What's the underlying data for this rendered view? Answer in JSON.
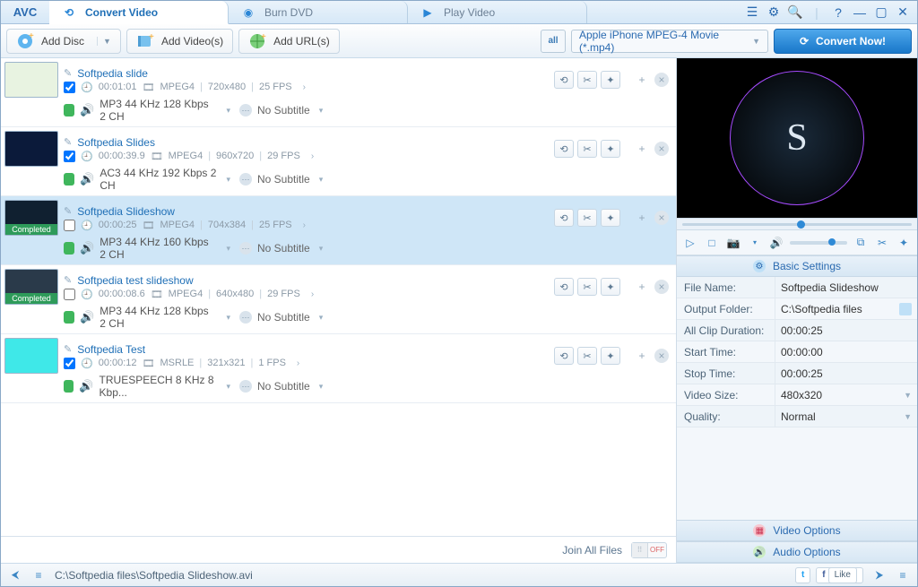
{
  "app": {
    "logo": "AVC"
  },
  "tabs": [
    {
      "label": "Convert Video",
      "active": true
    },
    {
      "label": "Burn DVD",
      "active": false
    },
    {
      "label": "Play Video",
      "active": false
    }
  ],
  "toolbar": {
    "add_disc": "Add Disc",
    "add_videos": "Add Video(s)",
    "add_urls": "Add URL(s)",
    "profile_tag": "all",
    "profile_label": "Apple iPhone MPEG-4 Movie (*.mp4)",
    "convert": "Convert Now!"
  },
  "items": [
    {
      "title": "Softpedia slide",
      "checked": true,
      "completed": false,
      "selected": false,
      "duration": "00:01:01",
      "codec": "MPEG4",
      "res": "720x480",
      "fps": "25 FPS",
      "audio": "MP3 44 KHz 128 Kbps 2 CH",
      "subtitle": "No Subtitle",
      "thumb_bg": "#e8f3e1"
    },
    {
      "title": "Softpedia Slides",
      "checked": true,
      "completed": false,
      "selected": false,
      "duration": "00:00:39.9",
      "codec": "MPEG4",
      "res": "960x720",
      "fps": "29 FPS",
      "audio": "AC3 44 KHz 192 Kbps 2 CH",
      "subtitle": "No Subtitle",
      "thumb_bg": "#0b1a3a"
    },
    {
      "title": "Softpedia Slideshow",
      "checked": false,
      "completed": true,
      "selected": true,
      "duration": "00:00:25",
      "codec": "MPEG4",
      "res": "704x384",
      "fps": "25 FPS",
      "audio": "MP3 44 KHz 160 Kbps 2 CH",
      "subtitle": "No Subtitle",
      "thumb_bg": "#102030"
    },
    {
      "title": "Softpedia test slideshow",
      "checked": false,
      "completed": true,
      "selected": false,
      "duration": "00:00:08.6",
      "codec": "MPEG4",
      "res": "640x480",
      "fps": "29 FPS",
      "audio": "MP3 44 KHz 128 Kbps 2 CH",
      "subtitle": "No Subtitle",
      "thumb_bg": "#2a3a4a"
    },
    {
      "title": "Softpedia Test",
      "checked": true,
      "completed": false,
      "selected": false,
      "duration": "00:00:12",
      "codec": "MSRLE",
      "res": "321x321",
      "fps": "1 FPS",
      "audio": "TRUESPEECH 8 KHz 8 Kbp...",
      "subtitle": "No Subtitle",
      "thumb_bg": "#3fe8e8"
    }
  ],
  "listfoot": {
    "join_label": "Join All Files",
    "toggle": "OFF"
  },
  "settings": {
    "header": "Basic Settings",
    "rows": {
      "fileName": {
        "k": "File Name:",
        "v": "Softpedia Slideshow"
      },
      "outFolder": {
        "k": "Output Folder:",
        "v": "C:\\Softpedia files"
      },
      "clipDur": {
        "k": "All Clip Duration:",
        "v": "00:00:25"
      },
      "start": {
        "k": "Start Time:",
        "v": "00:00:00"
      },
      "stop": {
        "k": "Stop Time:",
        "v": "00:00:25"
      },
      "vsize": {
        "k": "Video Size:",
        "v": "480x320"
      },
      "quality": {
        "k": "Quality:",
        "v": "Normal"
      }
    },
    "video_opts": "Video Options",
    "audio_opts": "Audio Options"
  },
  "status": {
    "path": "C:\\Softpedia files\\Softpedia Slideshow.avi",
    "like": "Like"
  }
}
